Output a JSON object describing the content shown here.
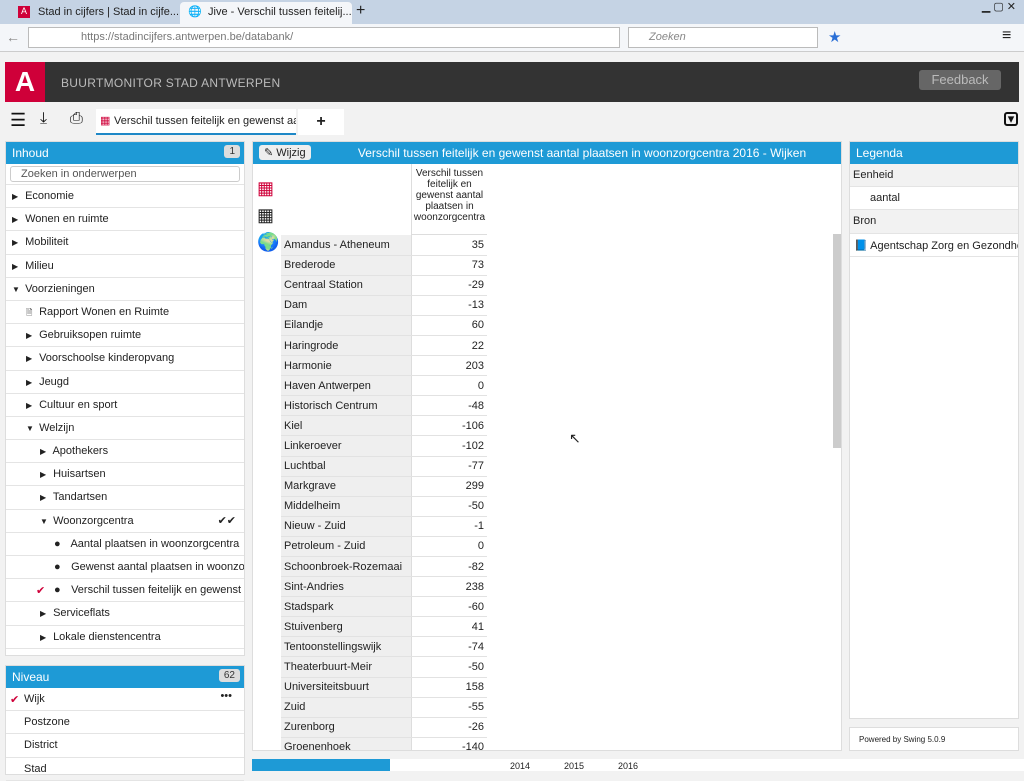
{
  "browser": {
    "tabs": [
      {
        "label": "Stad in cijfers | Stad in cijfe..."
      },
      {
        "label": "Jive - Verschil tussen feitelij..."
      }
    ],
    "url": "https://stadincijfers.antwerpen.be/databank/",
    "search_placeholder": "Zoeken"
  },
  "app": {
    "logo": "A",
    "title": "BUURTMONITOR STAD ANTWERPEN",
    "feedback": "Feedback"
  },
  "toolbar": {
    "tab_label": "Verschil tussen feitelijk en gewenst aantal plaatsen in woonzorgcentra",
    "add": "+"
  },
  "inhoud": {
    "title": "Inhoud",
    "count": "1",
    "search_placeholder": "Zoeken in onderwerpen",
    "items": [
      {
        "label": "Economie",
        "level": 0,
        "type": "collapsed"
      },
      {
        "label": "Wonen en ruimte",
        "level": 0,
        "type": "collapsed"
      },
      {
        "label": "Mobiliteit",
        "level": 0,
        "type": "collapsed"
      },
      {
        "label": "Milieu",
        "level": 0,
        "type": "collapsed"
      },
      {
        "label": "Voorzieningen",
        "level": 0,
        "type": "expanded"
      },
      {
        "label": "Rapport Wonen en Ruimte",
        "level": 1,
        "type": "doc"
      },
      {
        "label": "Gebruiksopen ruimte",
        "level": 1,
        "type": "collapsed"
      },
      {
        "label": "Voorschoolse kinderopvang",
        "level": 1,
        "type": "collapsed"
      },
      {
        "label": "Jeugd",
        "level": 1,
        "type": "collapsed"
      },
      {
        "label": "Cultuur en sport",
        "level": 1,
        "type": "collapsed"
      },
      {
        "label": "Welzijn",
        "level": 1,
        "type": "expanded"
      },
      {
        "label": "Apothekers",
        "level": 2,
        "type": "collapsed"
      },
      {
        "label": "Huisartsen",
        "level": 2,
        "type": "collapsed"
      },
      {
        "label": "Tandartsen",
        "level": 2,
        "type": "collapsed"
      },
      {
        "label": "Woonzorgcentra",
        "level": 2,
        "type": "expanded",
        "mark": "✔✔"
      },
      {
        "label": "Aantal plaatsen in woonzorgcentra",
        "level": 3,
        "type": "dot"
      },
      {
        "label": "Gewenst aantal plaatsen in woonzorgcentra",
        "level": 3,
        "type": "dot"
      },
      {
        "label": "Verschil tussen feitelijk en gewenst aantal plaatsen",
        "level": 3,
        "type": "dot",
        "checked": true
      },
      {
        "label": "Serviceflats",
        "level": 2,
        "type": "collapsed"
      },
      {
        "label": "Lokale dienstencentra",
        "level": 2,
        "type": "collapsed"
      }
    ]
  },
  "niveau": {
    "title": "Niveau",
    "count": "62",
    "items": [
      {
        "label": "Wijk",
        "checked": true,
        "more": "•••"
      },
      {
        "label": "Postzone"
      },
      {
        "label": "District"
      },
      {
        "label": "Stad"
      }
    ]
  },
  "main": {
    "edit": "Wijzig",
    "title": "Verschil tussen feitelijk en gewenst aantal plaatsen in woonzorgcentra 2016 - Wijken",
    "column_header": "Verschil tussen feitelijk en gewenst aantal plaatsen in woonzorgcentra",
    "rows": [
      [
        "Amandus - Atheneum",
        "35"
      ],
      [
        "Brederode",
        "73"
      ],
      [
        "Centraal Station",
        "-29"
      ],
      [
        "Dam",
        "-13"
      ],
      [
        "Eilandje",
        "60"
      ],
      [
        "Haringrode",
        "22"
      ],
      [
        "Harmonie",
        "203"
      ],
      [
        "Haven Antwerpen",
        "0"
      ],
      [
        "Historisch Centrum",
        "-48"
      ],
      [
        "Kiel",
        "-106"
      ],
      [
        "Linkeroever",
        "-102"
      ],
      [
        "Luchtbal",
        "-77"
      ],
      [
        "Markgrave",
        "299"
      ],
      [
        "Middelheim",
        "-50"
      ],
      [
        "Nieuw - Zuid",
        "-1"
      ],
      [
        "Petroleum - Zuid",
        "0"
      ],
      [
        "Schoonbroek-Rozemaai",
        "-82"
      ],
      [
        "Sint-Andries",
        "238"
      ],
      [
        "Stadspark",
        "-60"
      ],
      [
        "Stuivenberg",
        "41"
      ],
      [
        "Tentoonstellingswijk",
        "-74"
      ],
      [
        "Theaterbuurt-Meir",
        "-50"
      ],
      [
        "Universiteitsbuurt",
        "158"
      ],
      [
        "Zuid",
        "-55"
      ],
      [
        "Zurenborg",
        "-26"
      ],
      [
        "Groenenhoek",
        "-140"
      ]
    ]
  },
  "legend": {
    "title": "Legenda",
    "eenheid_label": "Eenheid",
    "eenheid": "aantal",
    "bron_label": "Bron",
    "bron": "Agentschap Zorg en Gezondheid, Zorgatlas",
    "powered": "Powered by Swing 5.0.9"
  },
  "bottom": {
    "years": [
      "2014",
      "2015",
      "2016"
    ]
  }
}
